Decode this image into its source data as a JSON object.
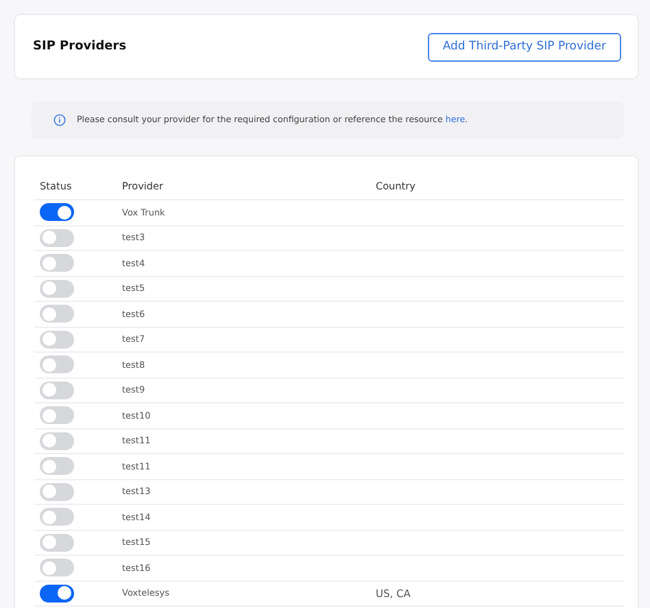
{
  "header": {
    "title": "SIP Providers",
    "add_button": "Add Third-Party SIP Provider"
  },
  "notice": {
    "text": "Please consult your provider for the required configuration or reference the resource",
    "link": "here",
    "end": "."
  },
  "table": {
    "columns": [
      "Status",
      "Provider",
      "Country"
    ],
    "rows": [
      {
        "on": true,
        "provider": "Vox Trunk",
        "country": ""
      },
      {
        "on": false,
        "provider": "test3",
        "country": ""
      },
      {
        "on": false,
        "provider": "test4",
        "country": ""
      },
      {
        "on": false,
        "provider": "test5",
        "country": ""
      },
      {
        "on": false,
        "provider": "test6",
        "country": ""
      },
      {
        "on": false,
        "provider": "test7",
        "country": ""
      },
      {
        "on": false,
        "provider": "test8",
        "country": ""
      },
      {
        "on": false,
        "provider": "test9",
        "country": ""
      },
      {
        "on": false,
        "provider": "test10",
        "country": ""
      },
      {
        "on": false,
        "provider": "test11",
        "country": ""
      },
      {
        "on": false,
        "provider": "test11",
        "country": ""
      },
      {
        "on": false,
        "provider": "test13",
        "country": ""
      },
      {
        "on": false,
        "provider": "test14",
        "country": ""
      },
      {
        "on": false,
        "provider": "test15",
        "country": ""
      },
      {
        "on": false,
        "provider": "test16",
        "country": ""
      },
      {
        "on": true,
        "provider": "Voxtelesys",
        "country": "US, CA"
      }
    ]
  }
}
